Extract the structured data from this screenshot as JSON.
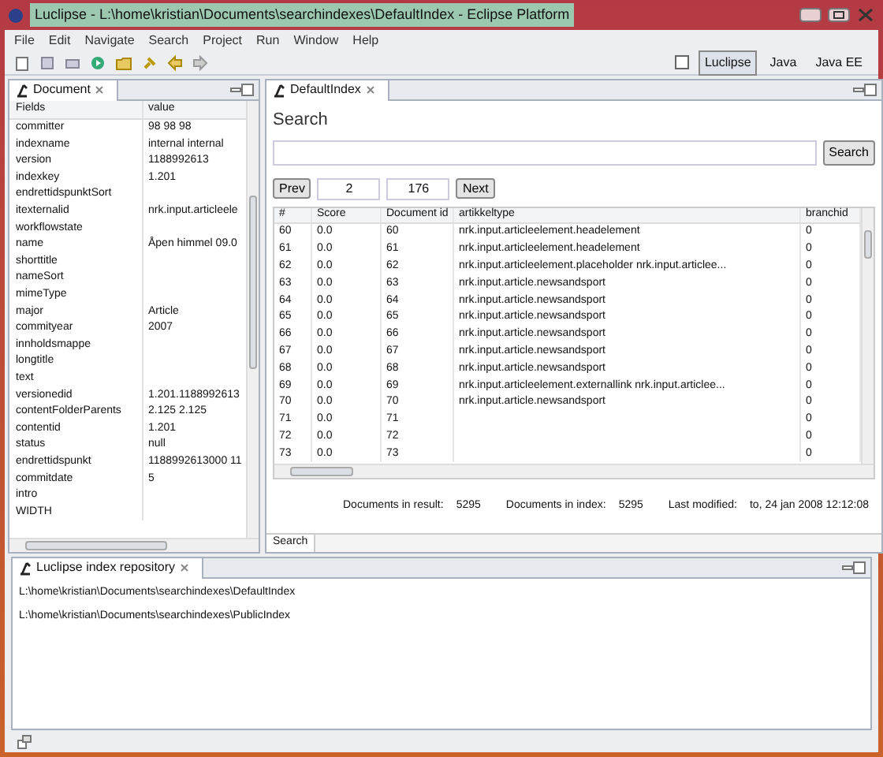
{
  "window": {
    "title": "Luclipse - L:\\home\\kristian\\Documents\\searchindexes\\DefaultIndex - Eclipse Platform"
  },
  "menu": [
    "File",
    "Edit",
    "Navigate",
    "Search",
    "Project",
    "Run",
    "Window",
    "Help"
  ],
  "perspectives": [
    {
      "label": "Luclipse",
      "selected": true
    },
    {
      "label": "Java",
      "selected": false
    },
    {
      "label": "Java EE",
      "selected": false
    }
  ],
  "document_view": {
    "tab": "Document",
    "columns": [
      "Fields",
      "value"
    ],
    "rows": [
      {
        "field": "committer",
        "value": "98 98 98"
      },
      {
        "field": "indexname",
        "value": "internal internal"
      },
      {
        "field": "version",
        "value": "1188992613"
      },
      {
        "field": "indexkey",
        "value": "1.201"
      },
      {
        "field": "endrettidspunktSort",
        "value": ""
      },
      {
        "field": "itexternalid",
        "value": "nrk.input.articleele"
      },
      {
        "field": "workflowstate",
        "value": ""
      },
      {
        "field": "name",
        "value": "Åpen himmel 09.0"
      },
      {
        "field": "shorttitle",
        "value": ""
      },
      {
        "field": "nameSort",
        "value": ""
      },
      {
        "field": "mimeType",
        "value": ""
      },
      {
        "field": "major",
        "value": "Article"
      },
      {
        "field": "commityear",
        "value": "2007"
      },
      {
        "field": "innholdsmappe",
        "value": ""
      },
      {
        "field": "longtitle",
        "value": ""
      },
      {
        "field": "text",
        "value": ""
      },
      {
        "field": "versionedid",
        "value": "1.201.1188992613"
      },
      {
        "field": "contentFolderParents",
        "value": "2.125  2.125"
      },
      {
        "field": "contentid",
        "value": "1.201"
      },
      {
        "field": "status",
        "value": "null"
      },
      {
        "field": "endrettidspunkt",
        "value": "1188992613000 11"
      },
      {
        "field": "commitdate",
        "value": "5"
      },
      {
        "field": "intro",
        "value": ""
      },
      {
        "field": "WIDTH",
        "value": ""
      }
    ]
  },
  "search_view": {
    "tab": "DefaultIndex",
    "heading": "Search",
    "search_button": "Search",
    "pager": {
      "prev": "Prev",
      "page": "2",
      "total": "176",
      "next": "Next"
    },
    "columns": [
      "#",
      "Score",
      "Document id",
      "artikkeltype",
      "branchid"
    ],
    "rows": [
      [
        "60",
        "0.0",
        "60",
        "nrk.input.articleelement.headelement",
        "0"
      ],
      [
        "61",
        "0.0",
        "61",
        "nrk.input.articleelement.headelement",
        "0"
      ],
      [
        "62",
        "0.0",
        "62",
        "nrk.input.articleelement.placeholder nrk.input.articlee...",
        "0"
      ],
      [
        "63",
        "0.0",
        "63",
        "nrk.input.article.newsandsport",
        "0"
      ],
      [
        "64",
        "0.0",
        "64",
        "nrk.input.article.newsandsport",
        "0"
      ],
      [
        "65",
        "0.0",
        "65",
        "nrk.input.article.newsandsport",
        "0"
      ],
      [
        "66",
        "0.0",
        "66",
        "nrk.input.article.newsandsport",
        "0"
      ],
      [
        "67",
        "0.0",
        "67",
        "nrk.input.article.newsandsport",
        "0"
      ],
      [
        "68",
        "0.0",
        "68",
        "nrk.input.article.newsandsport",
        "0"
      ],
      [
        "69",
        "0.0",
        "69",
        "nrk.input.articleelement.externallink nrk.input.articlee...",
        "0"
      ],
      [
        "70",
        "0.0",
        "70",
        "nrk.input.article.newsandsport",
        "0"
      ],
      [
        "71",
        "0.0",
        "71",
        "",
        "0"
      ],
      [
        "72",
        "0.0",
        "72",
        "",
        "0"
      ],
      [
        "73",
        "0.0",
        "73",
        "",
        "0"
      ]
    ],
    "summary": [
      {
        "label": "Documents in result:",
        "value": "5295"
      },
      {
        "label": "Documents in index:",
        "value": "5295"
      },
      {
        "label": "Last modified:",
        "value": "to, 24 jan 2008 12:12:08"
      }
    ],
    "bottom_tab": "Search"
  },
  "repository_view": {
    "tab": "Luclipse index repository",
    "items": [
      "L:\\home\\kristian\\Documents\\searchindexes\\DefaultIndex",
      "L:\\home\\kristian\\Documents\\searchindexes\\PublicIndex"
    ]
  }
}
